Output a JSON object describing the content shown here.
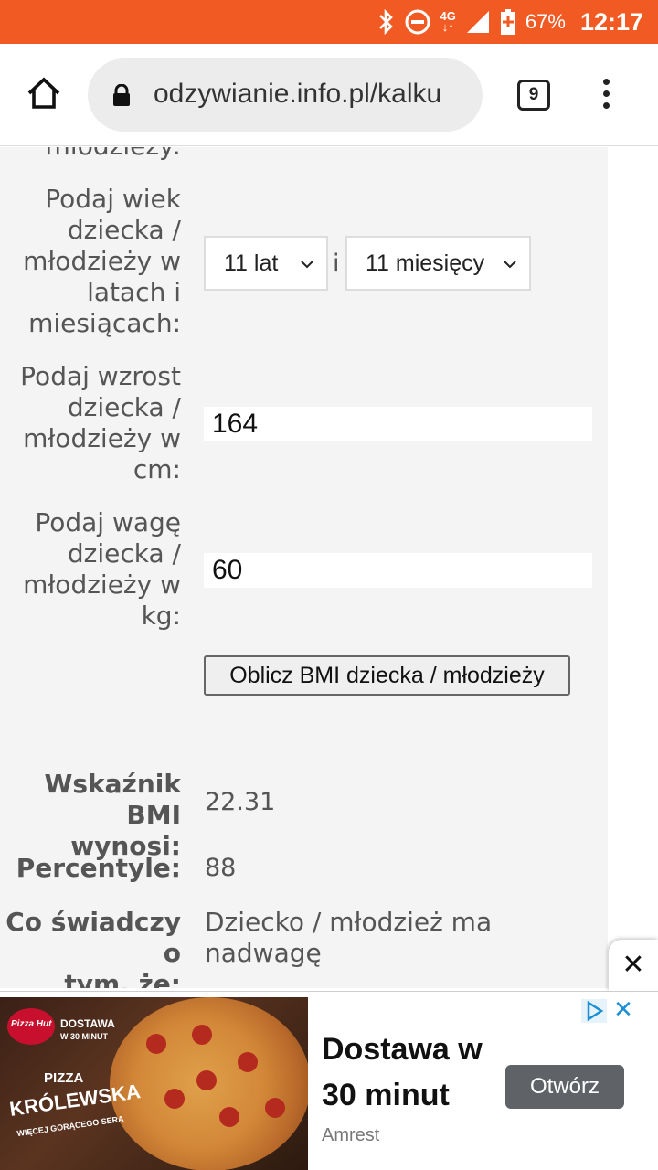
{
  "status_bar": {
    "network": "4G",
    "battery": "67%",
    "time": "12:17",
    "bg_color": "#f15a22"
  },
  "browser": {
    "url": "odzywianie.info.pl/kalku",
    "tab_count": "9"
  },
  "form": {
    "cut_label": "młodzieży:",
    "age_label": [
      "Podaj wiek",
      "dziecka /",
      "młodzieży w",
      "latach i",
      "miesiącach:"
    ],
    "age_years": "11 lat",
    "age_sep": "i",
    "age_months": "11 miesięcy",
    "height_label": [
      "Podaj wzrost",
      "dziecka /",
      "młodzieży w",
      "cm:"
    ],
    "height_value": "164",
    "weight_label": [
      "Podaj wagę",
      "dziecka /",
      "młodzieży w",
      "kg:"
    ],
    "weight_value": "60",
    "submit": "Oblicz BMI dziecka / młodzieży"
  },
  "results": {
    "bmi_label": [
      "Wskaźnik BMI",
      "wynosi:"
    ],
    "bmi_value": "22.31",
    "percentile_label": "Percentyle:",
    "percentile_value": "88",
    "meaning_label": [
      "Co świadczy o",
      "tym, że:"
    ],
    "meaning_value": [
      "Dziecko / młodzież ma",
      "nadwagę"
    ]
  },
  "ad": {
    "headline": "Dostawa w 30 minut",
    "brand": "Amrest",
    "open_button": "Otwórz",
    "image_text": {
      "delivery": "DOSTAWA",
      "delivery_sub": "W 30 MINUT",
      "pizza": "PIZZA",
      "name": "KRÓLEWSKA",
      "tagline": "WIĘCEJ GORĄCEGO SERA",
      "logo": "Pizza Hut"
    }
  }
}
